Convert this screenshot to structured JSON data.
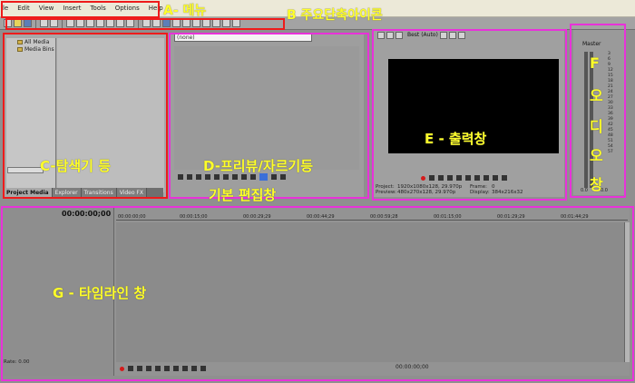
{
  "menu": [
    "ile",
    "Edit",
    "View",
    "Insert",
    "Tools",
    "Options",
    "Help"
  ],
  "labels": {
    "a": "A- 메뉴",
    "b": "B 주요단축아이콘",
    "c": "C-탐색기 등",
    "d": "D-프리뷰/자르기등",
    "d2": "기본 편집창",
    "e": "E - 출력창",
    "f": [
      "F",
      "오",
      "디",
      "오",
      "창"
    ],
    "g": "G - 타임라인 창"
  },
  "explorer": {
    "tree": [
      "All Media",
      "Media Bins"
    ],
    "tabs": [
      "Project Media",
      "Explorer",
      "Transitions",
      "Video FX"
    ]
  },
  "trimmer": {
    "combo": "(none)"
  },
  "preview": {
    "quality": "Best (Auto)",
    "info": {
      "project_k": "Project:",
      "project_v": "1920x1080x128, 29.970p",
      "preview_k": "Preview:",
      "preview_v": "480x270x128, 29.970p",
      "frame_k": "Frame:",
      "frame_v": "0",
      "display_k": "Display:",
      "display_v": "384x216x32"
    }
  },
  "mixer": {
    "title": "Master",
    "scale": [
      "3",
      "6",
      "9",
      "12",
      "15",
      "18",
      "21",
      "24",
      "27",
      "30",
      "33",
      "36",
      "39",
      "42",
      "45",
      "48",
      "51",
      "54",
      "57"
    ],
    "foot": [
      "0.0",
      "0.0"
    ]
  },
  "timeline": {
    "time": "00:00:00;00",
    "rate": "Rate: 0.00",
    "ticks": [
      "00:00:00;00",
      "00:00:15;00",
      "00:00:29;29",
      "00:00:44;29",
      "00:00:59;28",
      "00:01:15;00",
      "00:01:29;29",
      "00:01:44;29"
    ],
    "timecode": "00:00:00;00"
  }
}
